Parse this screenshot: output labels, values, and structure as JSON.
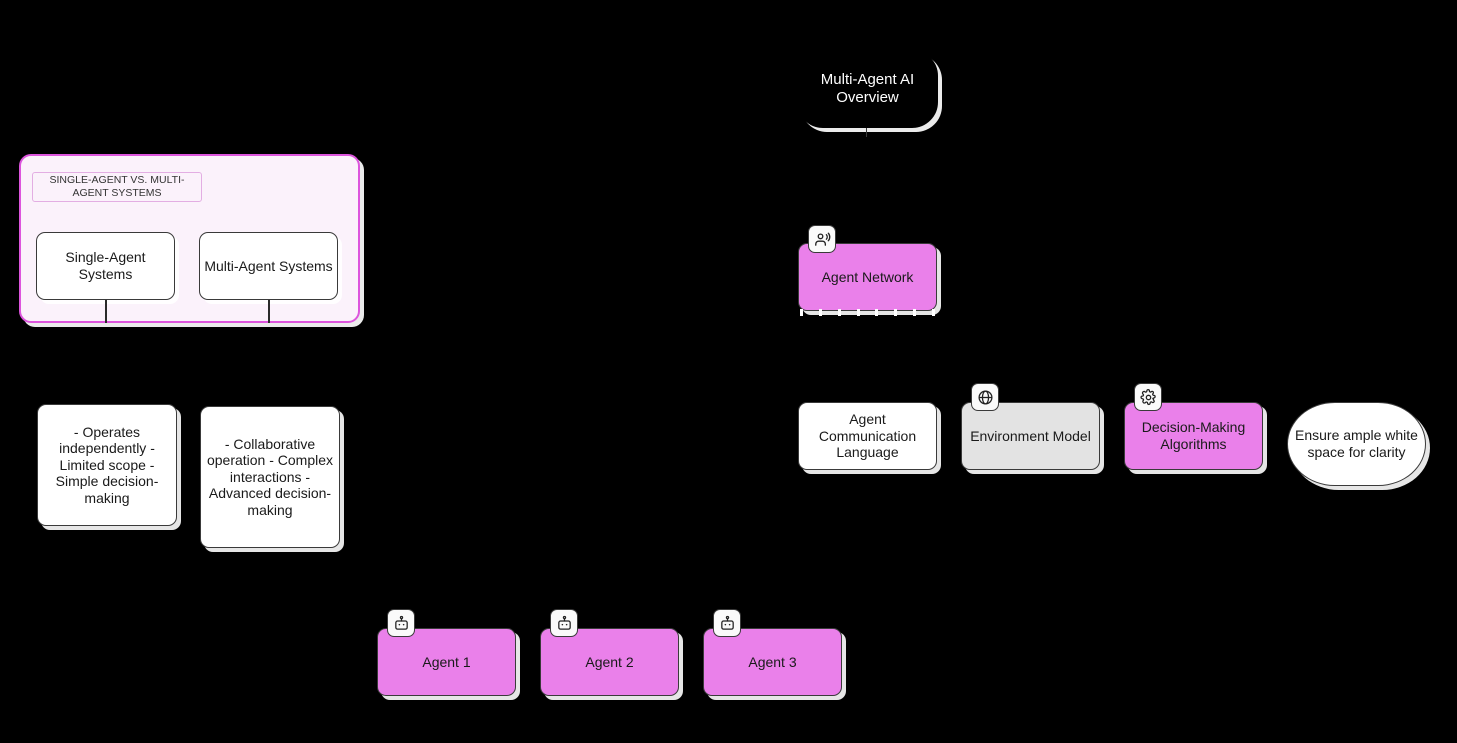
{
  "diagram": {
    "title_node": {
      "label": "Multi-Agent AI Overview"
    },
    "group": {
      "label": "SINGLE-AGENT VS. MULTI-AGENT SYSTEMS",
      "accent_color": "#dd55dd",
      "background_color": "#fbf2fb",
      "children": [
        {
          "label": "Single-Agent Systems"
        },
        {
          "label": "Multi-Agent Systems"
        }
      ]
    },
    "detail_boxes": [
      {
        "label": "- Operates independently - Limited scope - Simple decision-making"
      },
      {
        "label": "- Collaborative operation - Complex interactions - Advanced decision-making"
      }
    ],
    "agent_network": {
      "label": "Agent Network",
      "icon": "users-icon",
      "fill_color": "#ea80ea"
    },
    "component_row": [
      {
        "label": "Agent Communication Language",
        "icon": null,
        "fill_color": "#ffffff"
      },
      {
        "label": "Environment Model",
        "icon": "globe-icon",
        "fill_color": "#e3e3e3"
      },
      {
        "label": "Decision-Making Algorithms",
        "icon": "gear-icon",
        "fill_color": "#ea80ea"
      }
    ],
    "note_node": {
      "label": "Ensure ample white space for clarity"
    },
    "agents": [
      {
        "label": "Agent 1",
        "icon": "robot-icon",
        "fill_color": "#ea80ea"
      },
      {
        "label": "Agent 2",
        "icon": "robot-icon",
        "fill_color": "#ea80ea"
      },
      {
        "label": "Agent 3",
        "icon": "robot-icon",
        "fill_color": "#ea80ea"
      }
    ]
  }
}
